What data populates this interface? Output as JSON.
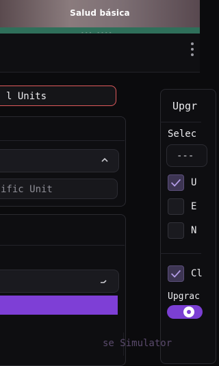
{
  "banner": {
    "title": "Salud básica",
    "progress_label": "--- ----",
    "progress_percent": 100
  },
  "left": {
    "units_input_value": "l Units",
    "specific_unit_placeholder": "ific Unit"
  },
  "right": {
    "title": "Upgr",
    "select_label": "Selec",
    "select_value": "---",
    "checkboxes": [
      {
        "label": "U",
        "checked": true
      },
      {
        "label": "E",
        "checked": false
      },
      {
        "label": "N",
        "checked": false
      },
      {
        "label": "Cl",
        "checked": true
      }
    ],
    "upgrade_label": "Upgrac",
    "toggle_on": true
  },
  "footer": {
    "text": "se Simulator"
  },
  "colors": {
    "accent": "#7e3fd6",
    "error_border": "#e05a5c"
  }
}
